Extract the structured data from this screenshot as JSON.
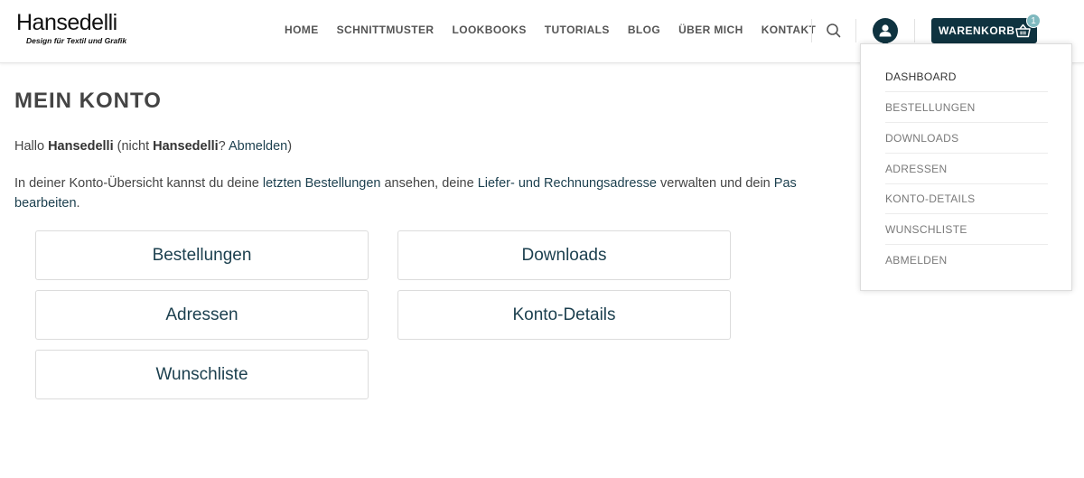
{
  "header": {
    "logo_title": "Hansedelli",
    "logo_subtitle": "Design für Textil und Grafik",
    "nav": [
      "HOME",
      "SCHNITTMUSTER",
      "LOOKBOOKS",
      "TUTORIALS",
      "BLOG",
      "ÜBER MICH",
      "KONTAKT"
    ],
    "cart_label": "WARENKORB",
    "cart_count": "1",
    "icons": [
      "search-icon",
      "user-icon",
      "basket-icon"
    ]
  },
  "account_menu": {
    "items": [
      "DASHBOARD",
      "BESTELLUNGEN",
      "DOWNLOADS",
      "ADRESSEN",
      "KONTO-DETAILS",
      "WUNSCHLISTE",
      "ABMELDEN"
    ],
    "active": "DASHBOARD"
  },
  "main": {
    "title": "MEIN KONTO",
    "greeting": {
      "hello": "Hallo ",
      "username": "Hansedelli",
      "not_open": " (nicht ",
      "username2": "Hansedelli",
      "q": "? ",
      "logout_link": "Abmelden",
      "close": ")"
    },
    "intro": {
      "t1": "In deiner Konto-Übersicht kannst du deine ",
      "link_orders": "letzten Bestellungen",
      "t2": " ansehen, deine ",
      "link_addresses": "Liefer- und Rechnungsadresse",
      "t3": " verwalten und dein ",
      "link_password_part1": "Pas",
      "link_password_part2": "bearbeiten",
      "t4": "."
    },
    "tiles": [
      "Bestellungen",
      "Downloads",
      "Adressen",
      "Konto-Details",
      "Wunschliste"
    ]
  },
  "colors": {
    "brand_dark": "#0f3340",
    "link": "#1b3f4e",
    "badge": "#7fb9bf"
  }
}
